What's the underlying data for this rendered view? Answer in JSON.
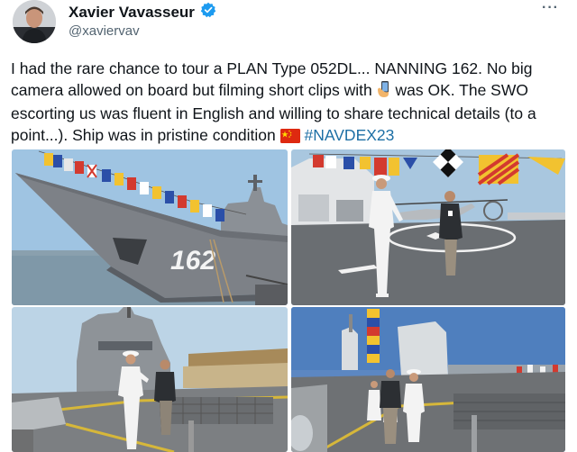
{
  "author": {
    "name": "Xavier Vavasseur",
    "handle": "@xaviervav",
    "verified_badge_icon": "verified-badge-icon"
  },
  "menu": {
    "more_label": "···"
  },
  "tweet": {
    "part1": "I had the rare chance to tour a PLAN Type 052DL... NANNING 162. No big camera allowed on board but filming short clips with ",
    "part2": " was OK. The SWO escorting us was fluent in English and willing to share technical details (to a point...). Ship was in pristine condition ",
    "hashtag": "#NAVDEX23",
    "phone_emoji_icon": "phone-emoji-icon",
    "flag_emoji_icon": "china-flag-icon"
  },
  "photos": [
    {
      "label": "ship-hull-photo",
      "hull_number": "162"
    },
    {
      "label": "flight-deck-photo"
    },
    {
      "label": "forecastle-guide-photo"
    },
    {
      "label": "deck-crew-photo"
    }
  ],
  "colors": {
    "hashtag": "#1d6fa5",
    "verified": "#1d9bf0",
    "secondary_text": "#536471",
    "hull_gray": "#7d8187",
    "sky": "#9fc4e2"
  }
}
